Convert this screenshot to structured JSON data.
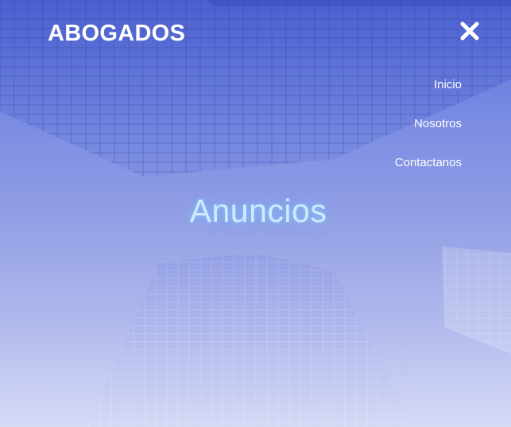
{
  "header": {
    "brand": "ABOGADOS",
    "close_icon": "close-x-icon"
  },
  "nav": {
    "items": [
      {
        "label": "Inicio"
      },
      {
        "label": "Nosotros"
      },
      {
        "label": "Contactanos"
      }
    ]
  },
  "hero": {
    "title": "Anuncios"
  },
  "colors": {
    "background_top": "#5a6fd8",
    "background_bottom": "#d6daf6",
    "text": "#ffffff",
    "title_glow": "#cfeaff"
  }
}
